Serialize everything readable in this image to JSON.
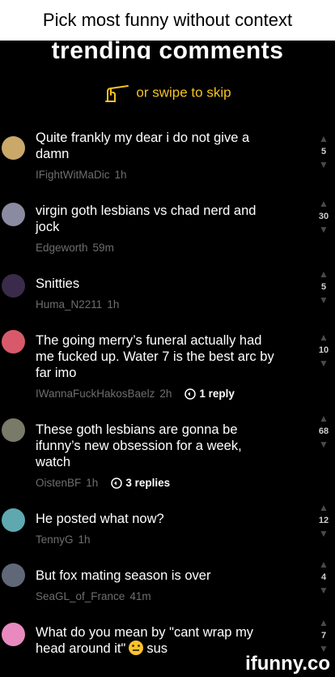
{
  "caption": "Pick most funny without context",
  "header_title": "trending comments",
  "hint": "or swipe to skip",
  "comments": [
    {
      "text": "Quite frankly my dear i do not give a damn",
      "user": "IFightWitMaDic",
      "time": "1h",
      "replies": "",
      "votes": "5",
      "avatar_color": "#c9a86a"
    },
    {
      "text": "virgin goth lesbians vs chad nerd and jock",
      "user": "Edgeworth",
      "time": "59m",
      "replies": "",
      "votes": "30",
      "avatar_color": "#8a8aa0"
    },
    {
      "text": "Snitties",
      "user": "Huma_N2211",
      "time": "1h",
      "replies": "",
      "votes": "5",
      "avatar_color": "#3a2b4a"
    },
    {
      "text": "The going merry’s funeral actually had me fucked up. Water 7 is the best arc by far imo",
      "user": "IWannaFuckHakosBaelz",
      "time": "2h",
      "replies": "1 reply",
      "votes": "10",
      "avatar_color": "#d85a6a"
    },
    {
      "text": "These goth lesbians are gonna be ifunny’s new obsession for a week, watch",
      "user": "OistenBF",
      "time": "1h",
      "replies": "3 replies",
      "votes": "68",
      "avatar_color": "#7a7a68"
    },
    {
      "text": "He posted what now?",
      "user": "TennyG",
      "time": "1h",
      "replies": "",
      "votes": "12",
      "avatar_color": "#5fa8b0"
    },
    {
      "text": "But fox mating season is over",
      "user": "SeaGL_of_France",
      "time": "41m",
      "replies": "",
      "votes": "4",
      "avatar_color": "#606878"
    },
    {
      "text": "What do you mean by \"cant wrap my head around it\"",
      "text_suffix": "sus",
      "user": "",
      "time": "",
      "replies": "",
      "votes": "7",
      "avatar_color": "#e88ac0"
    }
  ],
  "watermark": "ifunny.co",
  "colors": {
    "accent": "#f3c322",
    "meta": "#6e6e6e",
    "vote_arrow": "#4a4a4a"
  }
}
